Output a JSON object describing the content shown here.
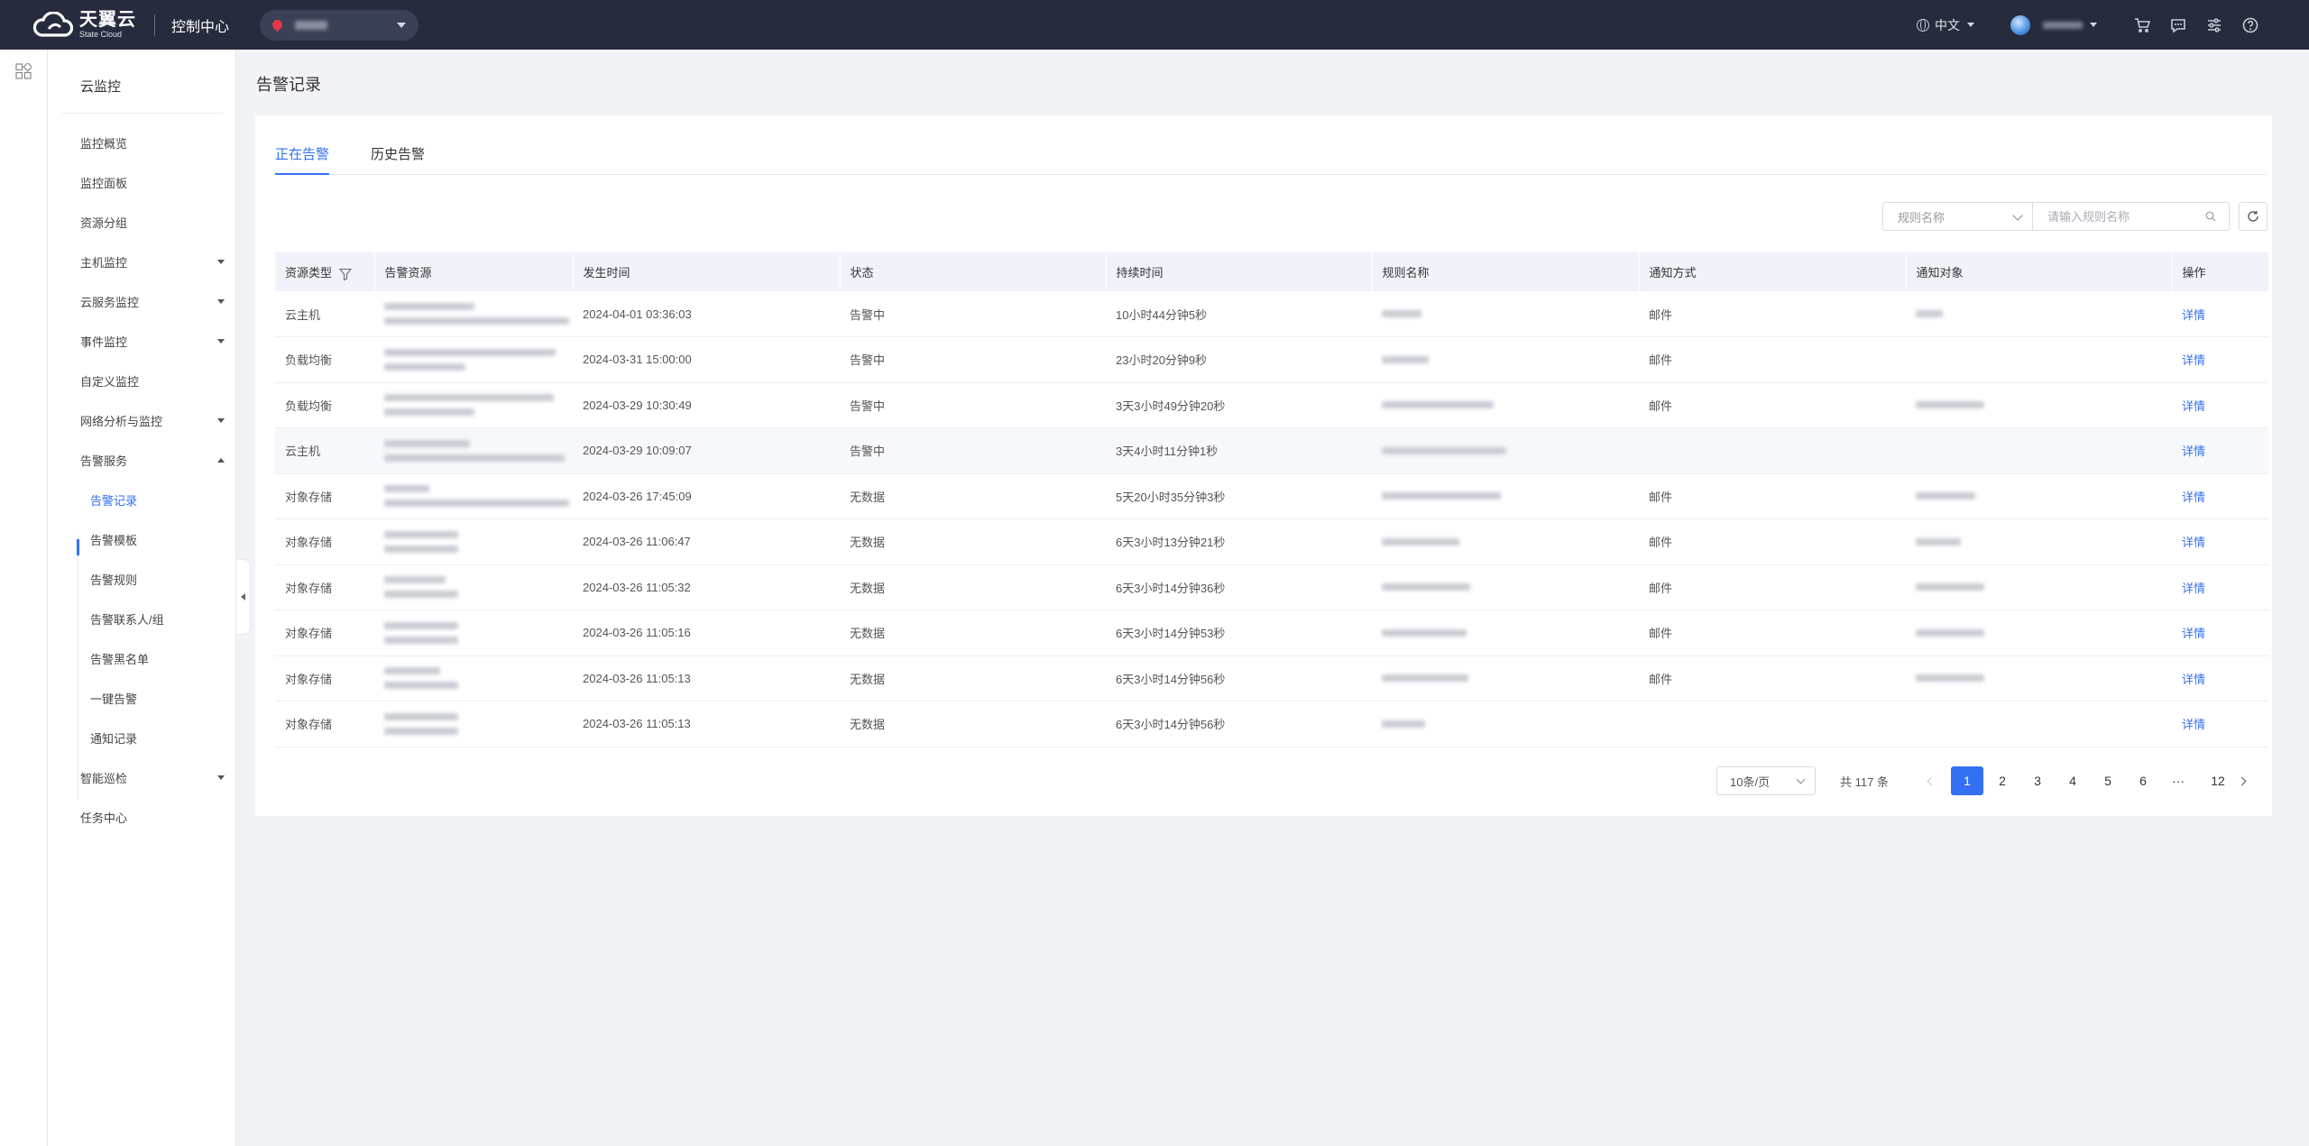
{
  "topbar": {
    "logo_cn": "天翼云",
    "logo_en": "State Cloud",
    "console_title": "控制中心",
    "lang": "中文"
  },
  "sidebar": {
    "title": "云监控",
    "items": [
      {
        "label": "监控概览",
        "arrow": ""
      },
      {
        "label": "监控面板",
        "arrow": ""
      },
      {
        "label": "资源分组",
        "arrow": ""
      },
      {
        "label": "主机监控",
        "arrow": "down"
      },
      {
        "label": "云服务监控",
        "arrow": "down"
      },
      {
        "label": "事件监控",
        "arrow": "down"
      },
      {
        "label": "自定义监控",
        "arrow": ""
      },
      {
        "label": "网络分析与监控",
        "arrow": "down"
      },
      {
        "label": "告警服务",
        "arrow": "up"
      }
    ],
    "sub_items": [
      "告警记录",
      "告警模板",
      "告警规则",
      "告警联系人/组",
      "告警黑名单",
      "一键告警",
      "通知记录"
    ],
    "bottom_items": [
      {
        "label": "智能巡检",
        "arrow": "down"
      },
      {
        "label": "任务中心",
        "arrow": ""
      }
    ]
  },
  "page": {
    "title": "告警记录",
    "tabs": [
      "正在告警",
      "历史告警"
    ],
    "search_select": "规则名称",
    "search_placeholder": "请输入规则名称"
  },
  "table": {
    "columns": [
      "资源类型",
      "告警资源",
      "发生时间",
      "状态",
      "持续时间",
      "规则名称",
      "通知方式",
      "通知对象",
      "操作"
    ],
    "rows": [
      {
        "type": "云主机",
        "time": "2024-04-01 03:36:03",
        "status": "告警中",
        "duration": "10小时44分钟5秒",
        "notify": "邮件",
        "action": "详情"
      },
      {
        "type": "负载均衡",
        "time": "2024-03-31 15:00:00",
        "status": "告警中",
        "duration": "23小时20分钟9秒",
        "notify": "邮件",
        "action": "详情"
      },
      {
        "type": "负载均衡",
        "time": "2024-03-29 10:30:49",
        "status": "告警中",
        "duration": "3天3小时49分钟20秒",
        "notify": "邮件",
        "action": "详情"
      },
      {
        "type": "云主机",
        "time": "2024-03-29 10:09:07",
        "status": "告警中",
        "duration": "3天4小时11分钟1秒",
        "notify": "",
        "action": "详情"
      },
      {
        "type": "对象存储",
        "time": "2024-03-26 17:45:09",
        "status": "无数据",
        "duration": "5天20小时35分钟3秒",
        "notify": "邮件",
        "action": "详情"
      },
      {
        "type": "对象存储",
        "time": "2024-03-26 11:06:47",
        "status": "无数据",
        "duration": "6天3小时13分钟21秒",
        "notify": "邮件",
        "action": "详情"
      },
      {
        "type": "对象存储",
        "time": "2024-03-26 11:05:32",
        "status": "无数据",
        "duration": "6天3小时14分钟36秒",
        "notify": "邮件",
        "action": "详情"
      },
      {
        "type": "对象存储",
        "time": "2024-03-26 11:05:16",
        "status": "无数据",
        "duration": "6天3小时14分钟53秒",
        "notify": "邮件",
        "action": "详情"
      },
      {
        "type": "对象存储",
        "time": "2024-03-26 11:05:13",
        "status": "无数据",
        "duration": "6天3小时14分钟56秒",
        "notify": "邮件",
        "action": "详情"
      },
      {
        "type": "对象存储",
        "time": "2024-03-26 11:05:13",
        "status": "无数据",
        "duration": "6天3小时14分钟56秒",
        "notify": "",
        "action": "详情"
      }
    ]
  },
  "pagination": {
    "page_size": "10条/页",
    "total": "共 117 条",
    "pages": [
      "1",
      "2",
      "3",
      "4",
      "5",
      "6",
      "···",
      "12"
    ],
    "current": "1"
  },
  "colors": {
    "topbar": "#262b3d",
    "accent": "#3371f2",
    "page_bg": "#f2f3f7"
  }
}
